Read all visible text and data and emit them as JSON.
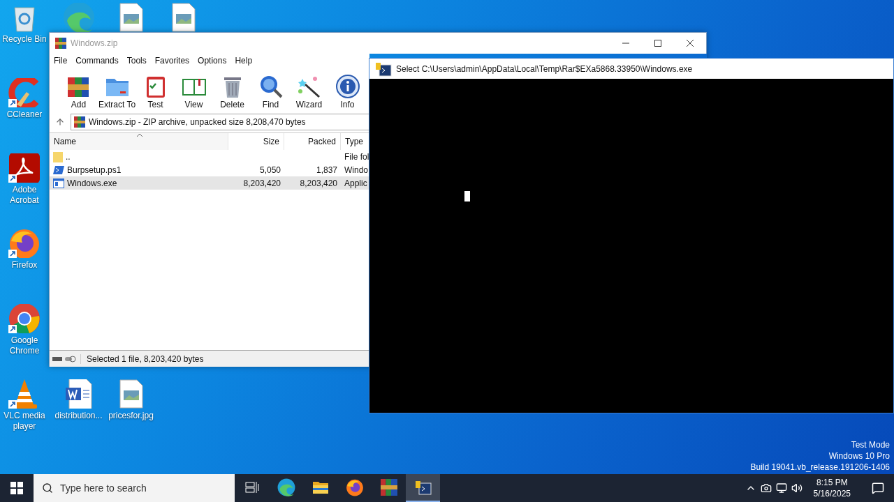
{
  "desktop": {
    "icon_rows": [
      [
        {
          "kind": "recycle",
          "label": "Recycle Bin",
          "shortcut": false
        },
        {
          "kind": "edge",
          "shortcut": false
        },
        {
          "kind": "image",
          "shortcut": false
        },
        {
          "kind": "image",
          "shortcut": false
        }
      ],
      [
        {
          "kind": "ccleaner",
          "label": "CCleaner",
          "shortcut": true
        }
      ],
      [
        {
          "kind": "acrobat",
          "label": "Adobe Acrobat",
          "shortcut": true
        }
      ],
      [
        {
          "kind": "firefox",
          "label": "Firefox",
          "shortcut": true
        }
      ],
      [
        {
          "kind": "chrome",
          "label": "Google Chrome",
          "shortcut": true
        }
      ],
      [
        {
          "kind": "vlc",
          "label": "VLC media player",
          "shortcut": true
        },
        {
          "kind": "word",
          "label": "distribution...",
          "shortcut": false
        },
        {
          "kind": "image",
          "label": "pricesfor.jpg",
          "shortcut": false
        }
      ]
    ],
    "watermark": [
      "Test Mode",
      "Windows 10 Pro",
      "Build 19041.vb_release.191206-1406"
    ]
  },
  "archive_window": {
    "title": "Windows.zip",
    "menu": [
      "File",
      "Commands",
      "Tools",
      "Favorites",
      "Options",
      "Help"
    ],
    "toolbar": [
      {
        "kind": "add",
        "label": "Add"
      },
      {
        "kind": "extract",
        "label": "Extract To"
      },
      {
        "kind": "test",
        "label": "Test"
      },
      {
        "kind": "view",
        "label": "View"
      },
      {
        "kind": "delete",
        "label": "Delete"
      },
      {
        "kind": "find",
        "label": "Find"
      },
      {
        "kind": "wizard",
        "label": "Wizard"
      },
      {
        "kind": "info",
        "label": "Info"
      }
    ],
    "path": "Windows.zip - ZIP archive, unpacked size 8,208,470 bytes",
    "columns": [
      {
        "label": "Name",
        "sorted": true
      },
      {
        "label": "Size",
        "sorted": false
      },
      {
        "label": "Packed",
        "sorted": false
      },
      {
        "label": "Type",
        "sorted": false
      }
    ],
    "rows": [
      {
        "kind": "folder",
        "name": "..",
        "size": "",
        "packed": "",
        "type": "File fol",
        "selected": false
      },
      {
        "kind": "script",
        "name": "Burpsetup.ps1",
        "size": "5,050",
        "packed": "1,837",
        "type": "Windo",
        "selected": false
      },
      {
        "kind": "exe",
        "name": "Windows.exe",
        "size": "8,203,420",
        "packed": "8,203,420",
        "type": "Applic",
        "selected": true
      }
    ],
    "status": "Selected 1 file, 8,203,420 bytes"
  },
  "console_window": {
    "title": "Select C:\\Users\\admin\\AppData\\Local\\Temp\\Rar$EXa5868.33950\\Windows.exe",
    "cursor": true
  },
  "taskbar": {
    "search": {
      "placeholder": "Type here to search"
    },
    "apps": [
      {
        "kind": "taskview",
        "active": false
      },
      {
        "kind": "edge",
        "active": false
      },
      {
        "kind": "explorer",
        "active": false
      },
      {
        "kind": "firefox",
        "active": false
      },
      {
        "kind": "winrar",
        "active": false
      },
      {
        "kind": "console",
        "active": true
      }
    ],
    "time": "8:15 PM",
    "date": "5/16/2025"
  }
}
